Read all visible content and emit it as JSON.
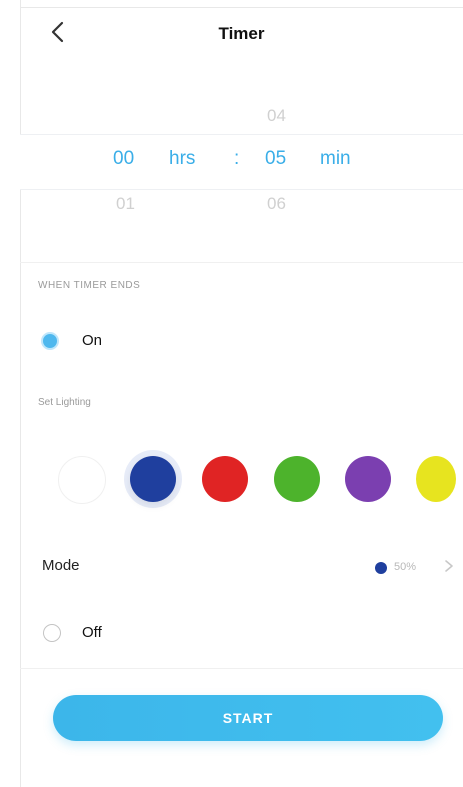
{
  "header": {
    "title": "Timer",
    "back_icon": "chevron-left-icon"
  },
  "picker": {
    "hours": {
      "above": "",
      "selected": "00",
      "below": "01",
      "below2": ""
    },
    "minutes": {
      "above2": "",
      "above": "04",
      "selected": "05",
      "below": "06",
      "below2": ""
    },
    "hours_unit": "hrs",
    "minutes_unit": "min",
    "separator": ":"
  },
  "timer_end": {
    "section_label": "WHEN TIMER ENDS",
    "on_label": "On",
    "lighting_label": "Set Lighting",
    "swatches": [
      {
        "name": "white",
        "color": "#ffffff"
      },
      {
        "name": "blue",
        "color": "#1f3f9e"
      },
      {
        "name": "red",
        "color": "#e02424"
      },
      {
        "name": "green",
        "color": "#4db32c"
      },
      {
        "name": "purple",
        "color": "#7b3fb0"
      },
      {
        "name": "yellow",
        "color": "#e7e41f"
      }
    ],
    "selected_swatch": "blue",
    "mode_label": "Mode",
    "mode_value": "50%",
    "mode_color": "#1f3f9e",
    "off_label": "Off"
  },
  "actions": {
    "start_label": "START"
  },
  "colors": {
    "accent": "#3aaee8"
  }
}
